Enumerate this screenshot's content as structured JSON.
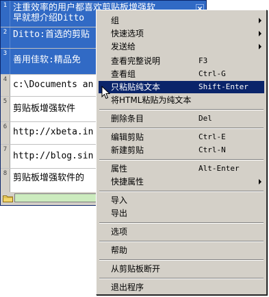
{
  "clips": [
    {
      "num": "1",
      "line1": "注重效率的用户都喜欢剪贴板增强软",
      "line2": "早就想介绍Ditto"
    },
    {
      "num": "2",
      "line1": "Ditto:首选的剪贴"
    },
    {
      "num": "3",
      "line1": "善用佳软:精品免"
    },
    {
      "num": "4",
      "line1": "c:\\Documents an"
    },
    {
      "num": "5",
      "line1": "剪贴板增强软件"
    },
    {
      "num": "6",
      "line1": "http://xbeta.in"
    },
    {
      "num": "7",
      "line1": "http://blog.sin"
    },
    {
      "num": "8",
      "line1": "剪贴板增强软件的"
    }
  ],
  "close_glyph": "×",
  "menu": {
    "group": "组",
    "quick_options": "快速选项",
    "send_to": "发送给",
    "view_full_desc": "查看完整说明",
    "view_full_desc_key": "F3",
    "view_group": "查看组",
    "view_group_key": "Ctrl-G",
    "paste_plain": "只粘贴纯文本",
    "paste_plain_key": "Shift-Enter",
    "paste_html_plain": "将HTML粘贴为纯文本",
    "delete_entry": "删除条目",
    "delete_entry_key": "Del",
    "edit_clip": "编辑剪贴",
    "edit_clip_key": "Ctrl-E",
    "new_clip": "新建剪贴",
    "new_clip_key": "Ctrl-N",
    "properties": "属性",
    "properties_key": "Alt-Enter",
    "quick_properties": "快捷属性",
    "import": "导入",
    "export": "导出",
    "options": "选项",
    "help": "帮助",
    "disconnect": "从剪贴板断开",
    "exit": "退出程序"
  },
  "colors": {
    "selection": "#316ac5",
    "menu_highlight": "#0a246a",
    "search_bg": "#ccebbe",
    "menu_bg": "#d4d0c8"
  }
}
